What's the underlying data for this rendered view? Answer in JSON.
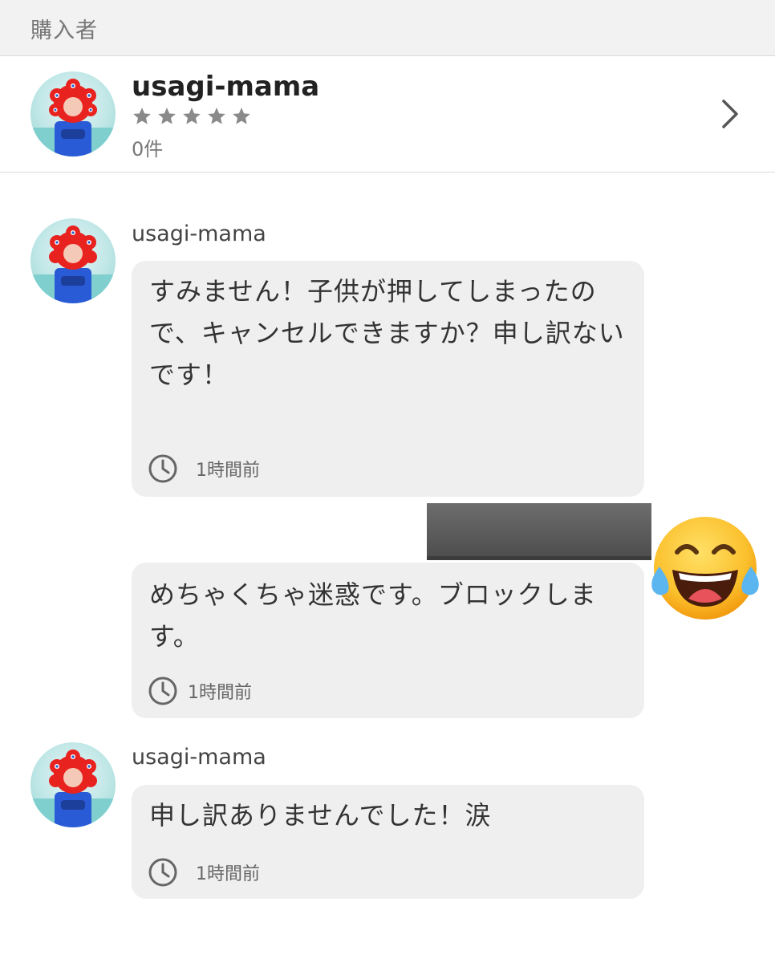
{
  "section": {
    "title": "購入者"
  },
  "buyer": {
    "name": "usagi-mama",
    "rating_stars": 5,
    "rating_filled": 0,
    "review_count": "0件",
    "avatar_icon": "mascot-avatar-icon",
    "chevron_icon": "chevron-right-icon"
  },
  "messages": [
    {
      "sender": "usagi-mama",
      "text": "すみません！子供が押してしまったので、キャンセルできますか？申し訳ないです！",
      "time": "1時間前"
    },
    {
      "sender": "",
      "text": "めちゃくちゃ迷惑です。ブロックします。",
      "time": "1時間前"
    },
    {
      "sender": "usagi-mama",
      "text": "申し訳ありませんでした！涙",
      "time": "1時間前"
    }
  ],
  "overlay": {
    "emoji": "face-with-tears-of-joy-emoji",
    "redaction": "redacted-name-bar"
  },
  "colors": {
    "header_bg": "#f2f2f2",
    "bubble_bg": "#efefef",
    "star": "#8a8a8a",
    "text": "#333333"
  }
}
